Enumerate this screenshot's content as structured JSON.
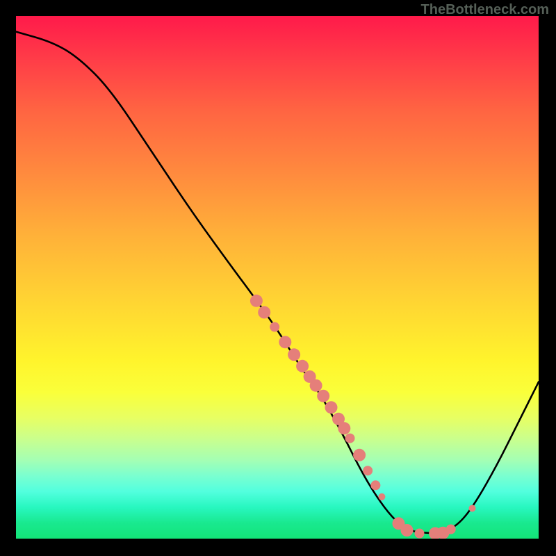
{
  "watermark": "TheBottleneck.com",
  "chart_data": {
    "type": "line",
    "title": "",
    "xlabel": "",
    "ylabel": "",
    "x_range": [
      0,
      100
    ],
    "y_range": [
      0,
      100
    ],
    "curve_label": "bottleneck-curve",
    "curve": [
      {
        "x": 0,
        "y": 97
      },
      {
        "x": 7,
        "y": 95
      },
      {
        "x": 12,
        "y": 92
      },
      {
        "x": 18,
        "y": 86
      },
      {
        "x": 26,
        "y": 74
      },
      {
        "x": 34,
        "y": 62
      },
      {
        "x": 42,
        "y": 51
      },
      {
        "x": 45,
        "y": 47
      },
      {
        "x": 50,
        "y": 40
      },
      {
        "x": 55,
        "y": 32
      },
      {
        "x": 58,
        "y": 28
      },
      {
        "x": 62,
        "y": 21
      },
      {
        "x": 66,
        "y": 13
      },
      {
        "x": 69,
        "y": 8
      },
      {
        "x": 72,
        "y": 4
      },
      {
        "x": 75,
        "y": 1.5
      },
      {
        "x": 79,
        "y": 1
      },
      {
        "x": 82,
        "y": 1.2
      },
      {
        "x": 85,
        "y": 3
      },
      {
        "x": 88,
        "y": 7
      },
      {
        "x": 92,
        "y": 14
      },
      {
        "x": 96,
        "y": 22
      },
      {
        "x": 100,
        "y": 30
      }
    ],
    "marker_clusters": [
      {
        "x": 46,
        "y": 45.5,
        "size": "big"
      },
      {
        "x": 47.5,
        "y": 43.3,
        "size": "big"
      },
      {
        "x": 49.5,
        "y": 40.5,
        "size": "med"
      },
      {
        "x": 51.5,
        "y": 37.6,
        "size": "big"
      },
      {
        "x": 53.2,
        "y": 35.2,
        "size": "big"
      },
      {
        "x": 54.8,
        "y": 33.0,
        "size": "big"
      },
      {
        "x": 56.2,
        "y": 31.0,
        "size": "big"
      },
      {
        "x": 57.4,
        "y": 29.3,
        "size": "big"
      },
      {
        "x": 58.8,
        "y": 27.3,
        "size": "big"
      },
      {
        "x": 60.3,
        "y": 25.1,
        "size": "big"
      },
      {
        "x": 61.7,
        "y": 22.9,
        "size": "big"
      },
      {
        "x": 62.8,
        "y": 21.1,
        "size": "big"
      },
      {
        "x": 63.9,
        "y": 19.2,
        "size": "med"
      },
      {
        "x": 65.7,
        "y": 16.0,
        "size": "big"
      },
      {
        "x": 67.3,
        "y": 13.0,
        "size": "med"
      },
      {
        "x": 68.8,
        "y": 10.2,
        "size": "med"
      },
      {
        "x": 70.0,
        "y": 8.0,
        "size": "sm"
      },
      {
        "x": 73.2,
        "y": 2.9,
        "size": "big"
      },
      {
        "x": 74.8,
        "y": 1.6,
        "size": "big"
      },
      {
        "x": 77.2,
        "y": 1.0,
        "size": "med"
      },
      {
        "x": 80.2,
        "y": 1.0,
        "size": "big"
      },
      {
        "x": 81.7,
        "y": 1.1,
        "size": "big"
      },
      {
        "x": 83.2,
        "y": 1.8,
        "size": "med"
      },
      {
        "x": 87.3,
        "y": 5.8,
        "size": "sm"
      }
    ]
  }
}
